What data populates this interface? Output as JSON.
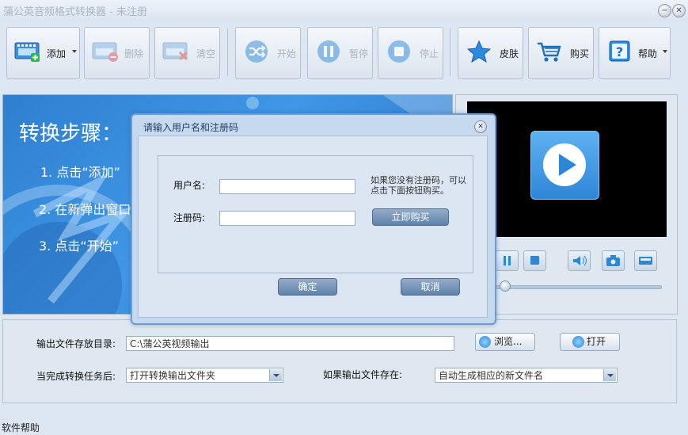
{
  "app": {
    "title": "蒲公英音频格式转换器 - 未注册"
  },
  "toolbar": {
    "add": "添加",
    "delete": "删除",
    "clear": "清空",
    "start": "开始",
    "pause": "暂停",
    "stop": "停止",
    "skin": "皮肤",
    "buy": "购买",
    "help": "帮助"
  },
  "banner": {
    "heading": "转换步骤：",
    "step1": "1. 点击“添加”",
    "step2": "2. 在新弹出窗口",
    "step3": "3. 点击“开始”"
  },
  "settings": {
    "output_dir_label": "输出文件存放目录:",
    "output_dir_value": "C:\\蒲公英视频输出",
    "browse": "浏览...",
    "open": "打开",
    "after_done_label": "当完成转换任务后:",
    "after_done_value": "打开转换输出文件夹",
    "if_exists_label": "如果输出文件存在:",
    "if_exists_value": "自动生成相应的新文件名"
  },
  "status": {
    "text": "软件帮助"
  },
  "dialog": {
    "title": "请输入用户名和注册码",
    "username_label": "用户名:",
    "code_label": "注册码:",
    "hint": "如果您没有注册码，可以点击下面按钮购买。",
    "buy_now": "立即购买",
    "ok": "确定",
    "cancel": "取消"
  },
  "colors": {
    "accent": "#3b8fdb",
    "dialog_button": "#6f8fb5"
  }
}
